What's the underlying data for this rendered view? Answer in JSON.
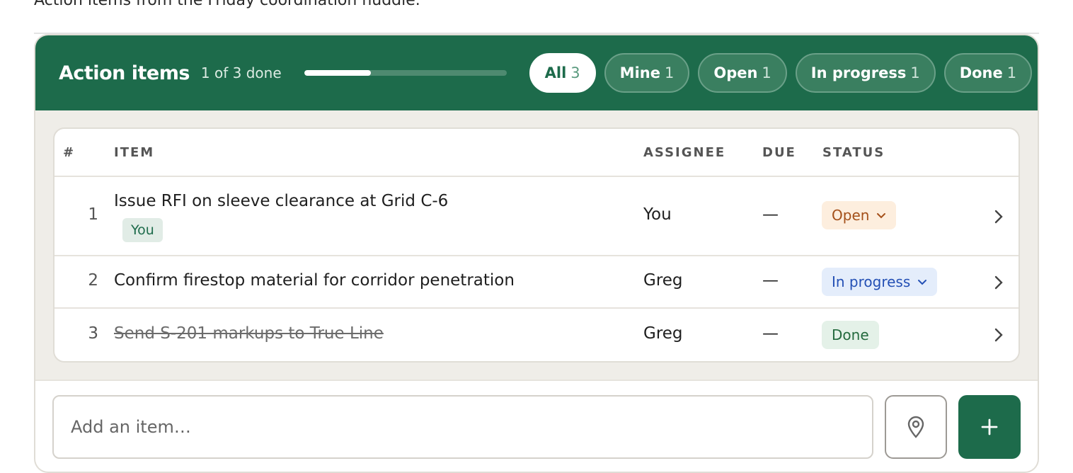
{
  "page": {
    "subtitle": "Action items from the Friday coordination huddle."
  },
  "header": {
    "title": "Action items",
    "done_count": "1 of 3 done",
    "progress_fraction": 0.33,
    "filters": [
      {
        "label": "All",
        "count": "3",
        "active": true
      },
      {
        "label": "Mine",
        "count": "1",
        "active": false
      },
      {
        "label": "Open",
        "count": "1",
        "active": false
      },
      {
        "label": "In progress",
        "count": "1",
        "active": false
      },
      {
        "label": "Done",
        "count": "1",
        "active": false
      }
    ]
  },
  "table": {
    "columns": {
      "num": "#",
      "item": "ITEM",
      "assignee": "ASSIGNEE",
      "due": "DUE",
      "status": "STATUS"
    },
    "rows": [
      {
        "num": "1",
        "item": "Issue RFI on sleeve clearance at Grid C-6",
        "tag": "You",
        "assignee": "You",
        "due": "—",
        "status": "Open"
      },
      {
        "num": "2",
        "item": "Confirm firestop material for corridor penetration",
        "assignee": "Greg",
        "due": "—",
        "status": "In progress"
      },
      {
        "num": "3",
        "item": "Send S-201 markups to True Line",
        "assignee": "Greg",
        "due": "—",
        "status": "Done"
      }
    ]
  },
  "composer": {
    "placeholder": "Add an item…",
    "location_icon": "map-pin-icon",
    "add_icon": "plus-icon"
  },
  "colors": {
    "brand_green": "#1d6b4b",
    "open": "#a4501a",
    "in_progress": "#2450b5",
    "done": "#246a3e"
  }
}
